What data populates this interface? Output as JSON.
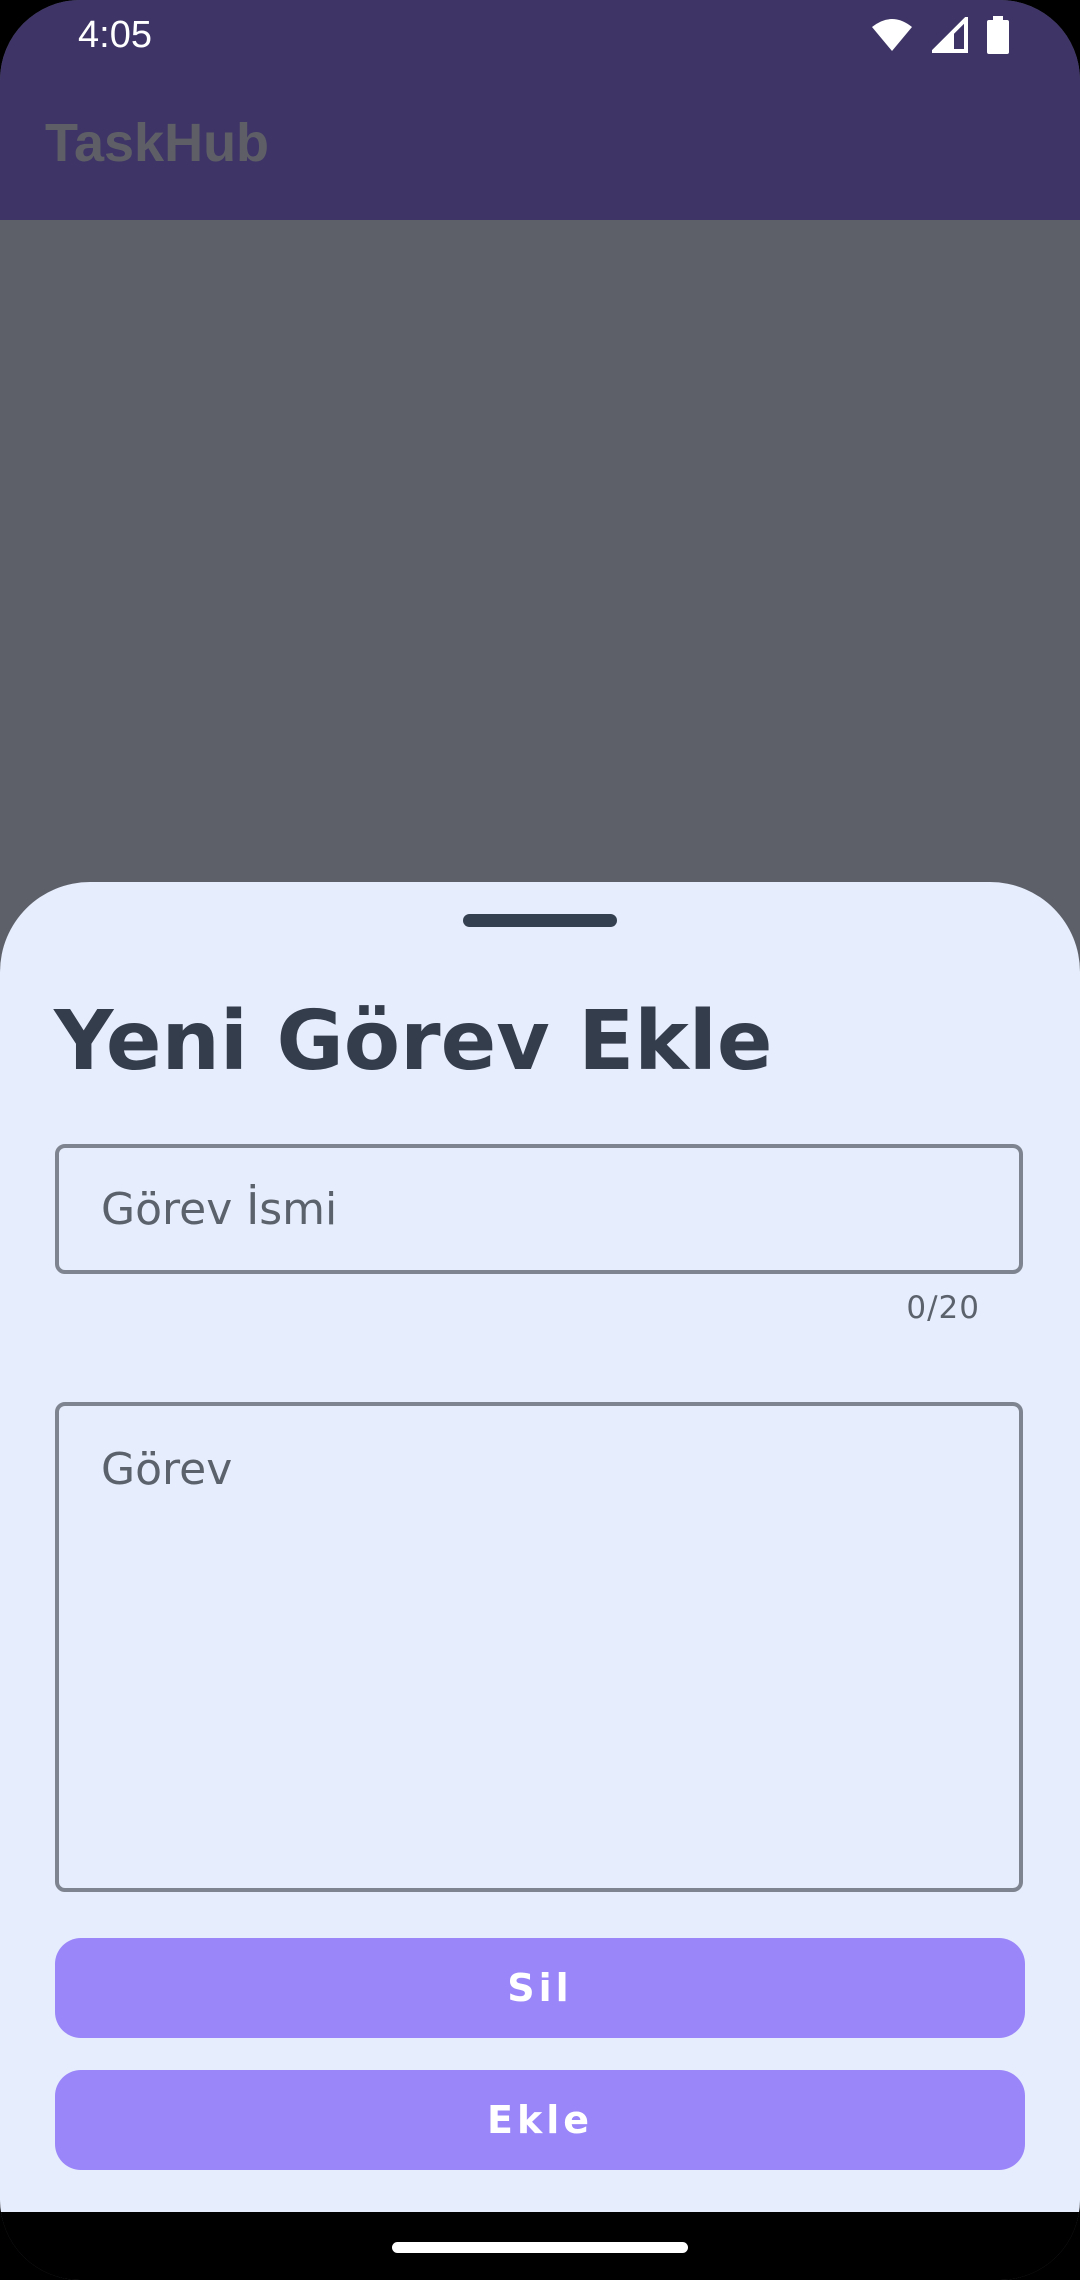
{
  "status_bar": {
    "time": "4:05",
    "icons": [
      "wifi-icon",
      "cellular-signal-icon",
      "battery-icon"
    ]
  },
  "app_bar": {
    "title": "TaskHub"
  },
  "sheet": {
    "title": "Yeni Görev Ekle",
    "name_field": {
      "placeholder": "Görev İsmi",
      "value": "",
      "counter": "0/20"
    },
    "task_field": {
      "placeholder": "Görev",
      "value": ""
    },
    "delete_button_label": "Sil",
    "add_button_label": "Ekle"
  },
  "colors": {
    "accent": "#9a86f9",
    "sheet_background": "#e6edfc",
    "app_bar": "#3e3566",
    "scrim": "#5d6069"
  }
}
